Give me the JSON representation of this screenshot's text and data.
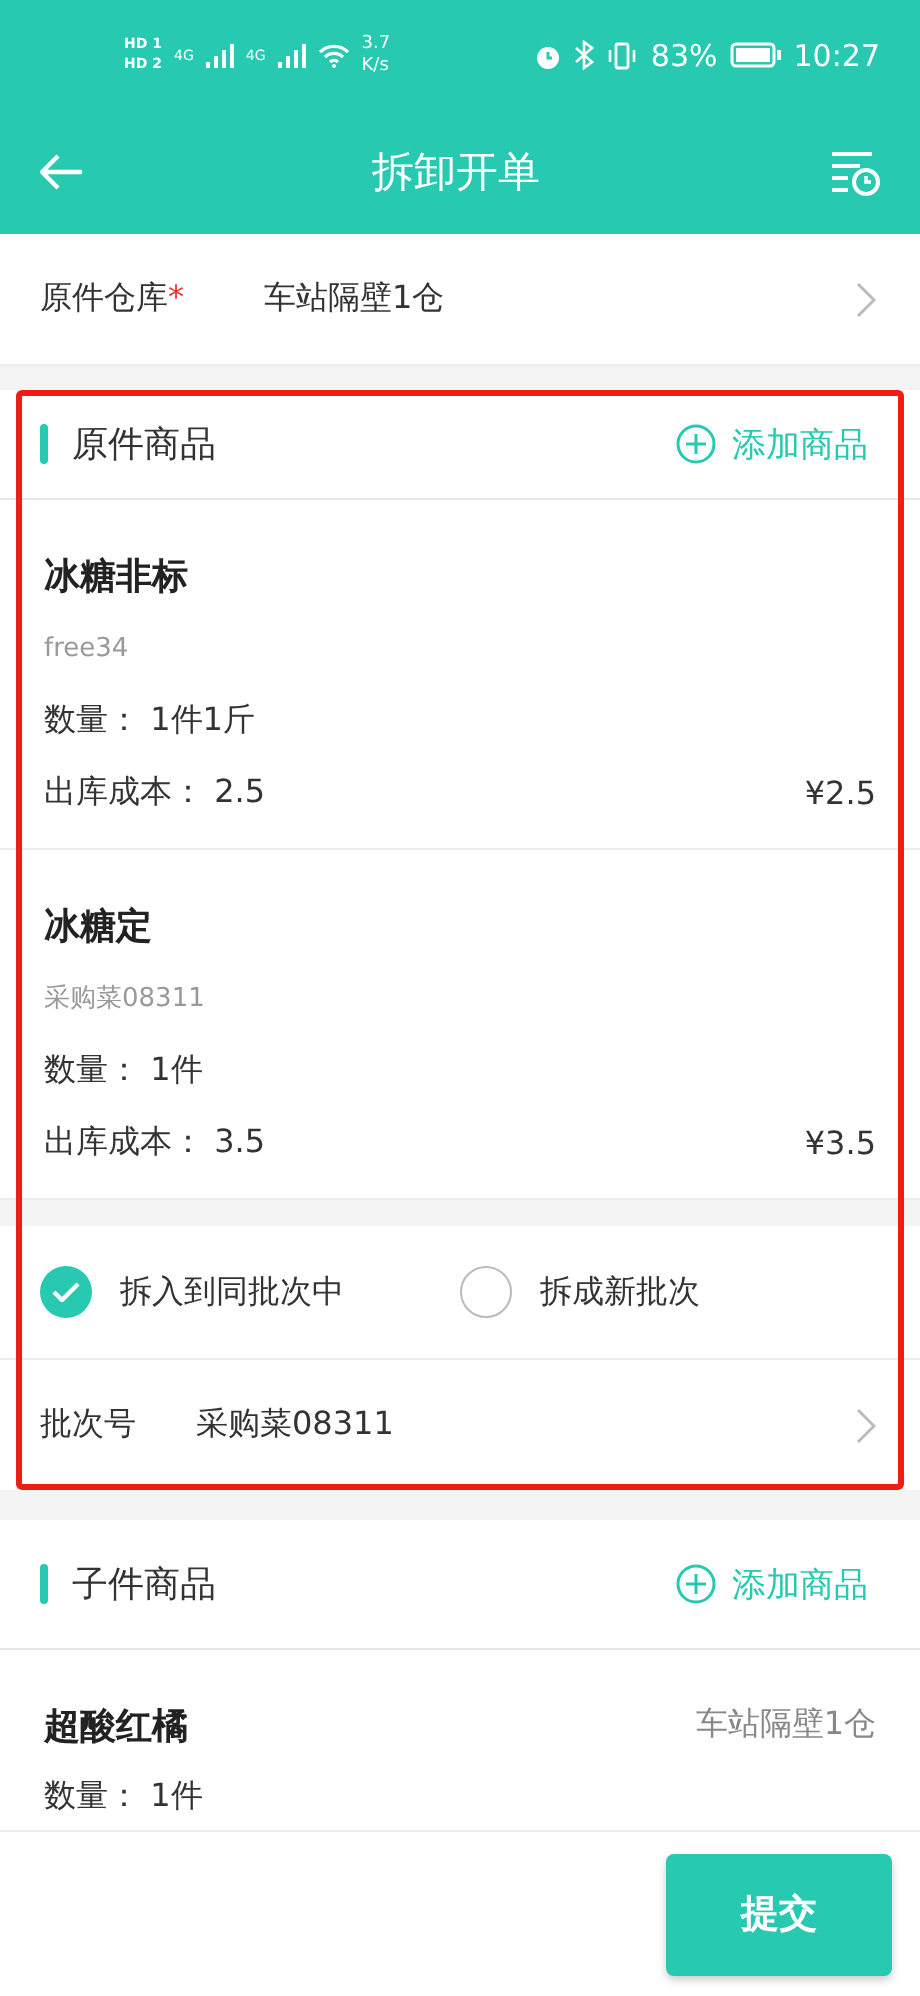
{
  "status_bar": {
    "sims": [
      {
        "hd": "HD",
        "slot": "1",
        "network": "4G"
      },
      {
        "hd": "HD",
        "slot": "2",
        "network": "4G"
      }
    ],
    "speed": "3.7",
    "speed_unit": "K/s",
    "battery": "83%",
    "time": "10:27"
  },
  "header": {
    "title": "拆卸开单"
  },
  "warehouse": {
    "label": "原件仓库",
    "required": true,
    "required_mark": "*",
    "value": "车站隔壁1仓"
  },
  "original_section": {
    "title": "原件商品",
    "add_label": "添加商品",
    "highlighted": true,
    "items": [
      {
        "name": "冰糖非标",
        "code": "free34",
        "quantity_label": "数量：",
        "quantity": "1件1斤",
        "cost_label": "出库成本：",
        "cost": "2.5",
        "amount": "¥2.5"
      },
      {
        "name": "冰糖定",
        "code": "采购菜08311",
        "quantity_label": "数量：",
        "quantity": "1件",
        "cost_label": "出库成本：",
        "cost": "3.5",
        "amount": "¥3.5"
      }
    ],
    "batch_options": [
      {
        "label": "拆入到同批次中",
        "selected": true
      },
      {
        "label": "拆成新批次",
        "selected": false
      }
    ],
    "batch": {
      "label": "批次号",
      "value": "采购菜08311"
    }
  },
  "child_section": {
    "title": "子件商品",
    "add_label": "添加商品",
    "items": [
      {
        "name": "超酸红橘",
        "warehouse": "车站隔壁1仓",
        "quantity_label": "数量：",
        "quantity": "1件"
      }
    ]
  },
  "footer": {
    "submit": "提交"
  }
}
